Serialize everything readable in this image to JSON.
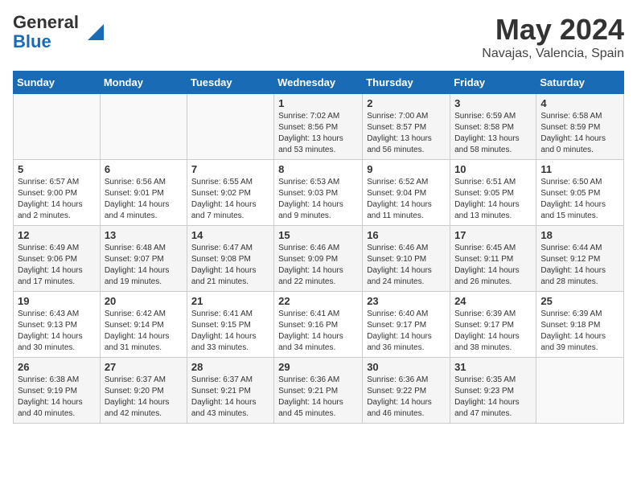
{
  "header": {
    "logo_general": "General",
    "logo_blue": "Blue",
    "month_year": "May 2024",
    "location": "Navajas, Valencia, Spain"
  },
  "weekdays": [
    "Sunday",
    "Monday",
    "Tuesday",
    "Wednesday",
    "Thursday",
    "Friday",
    "Saturday"
  ],
  "weeks": [
    [
      {
        "day": "",
        "info": ""
      },
      {
        "day": "",
        "info": ""
      },
      {
        "day": "",
        "info": ""
      },
      {
        "day": "1",
        "info": "Sunrise: 7:02 AM\nSunset: 8:56 PM\nDaylight: 13 hours\nand 53 minutes."
      },
      {
        "day": "2",
        "info": "Sunrise: 7:00 AM\nSunset: 8:57 PM\nDaylight: 13 hours\nand 56 minutes."
      },
      {
        "day": "3",
        "info": "Sunrise: 6:59 AM\nSunset: 8:58 PM\nDaylight: 13 hours\nand 58 minutes."
      },
      {
        "day": "4",
        "info": "Sunrise: 6:58 AM\nSunset: 8:59 PM\nDaylight: 14 hours\nand 0 minutes."
      }
    ],
    [
      {
        "day": "5",
        "info": "Sunrise: 6:57 AM\nSunset: 9:00 PM\nDaylight: 14 hours\nand 2 minutes."
      },
      {
        "day": "6",
        "info": "Sunrise: 6:56 AM\nSunset: 9:01 PM\nDaylight: 14 hours\nand 4 minutes."
      },
      {
        "day": "7",
        "info": "Sunrise: 6:55 AM\nSunset: 9:02 PM\nDaylight: 14 hours\nand 7 minutes."
      },
      {
        "day": "8",
        "info": "Sunrise: 6:53 AM\nSunset: 9:03 PM\nDaylight: 14 hours\nand 9 minutes."
      },
      {
        "day": "9",
        "info": "Sunrise: 6:52 AM\nSunset: 9:04 PM\nDaylight: 14 hours\nand 11 minutes."
      },
      {
        "day": "10",
        "info": "Sunrise: 6:51 AM\nSunset: 9:05 PM\nDaylight: 14 hours\nand 13 minutes."
      },
      {
        "day": "11",
        "info": "Sunrise: 6:50 AM\nSunset: 9:05 PM\nDaylight: 14 hours\nand 15 minutes."
      }
    ],
    [
      {
        "day": "12",
        "info": "Sunrise: 6:49 AM\nSunset: 9:06 PM\nDaylight: 14 hours\nand 17 minutes."
      },
      {
        "day": "13",
        "info": "Sunrise: 6:48 AM\nSunset: 9:07 PM\nDaylight: 14 hours\nand 19 minutes."
      },
      {
        "day": "14",
        "info": "Sunrise: 6:47 AM\nSunset: 9:08 PM\nDaylight: 14 hours\nand 21 minutes."
      },
      {
        "day": "15",
        "info": "Sunrise: 6:46 AM\nSunset: 9:09 PM\nDaylight: 14 hours\nand 22 minutes."
      },
      {
        "day": "16",
        "info": "Sunrise: 6:46 AM\nSunset: 9:10 PM\nDaylight: 14 hours\nand 24 minutes."
      },
      {
        "day": "17",
        "info": "Sunrise: 6:45 AM\nSunset: 9:11 PM\nDaylight: 14 hours\nand 26 minutes."
      },
      {
        "day": "18",
        "info": "Sunrise: 6:44 AM\nSunset: 9:12 PM\nDaylight: 14 hours\nand 28 minutes."
      }
    ],
    [
      {
        "day": "19",
        "info": "Sunrise: 6:43 AM\nSunset: 9:13 PM\nDaylight: 14 hours\nand 30 minutes."
      },
      {
        "day": "20",
        "info": "Sunrise: 6:42 AM\nSunset: 9:14 PM\nDaylight: 14 hours\nand 31 minutes."
      },
      {
        "day": "21",
        "info": "Sunrise: 6:41 AM\nSunset: 9:15 PM\nDaylight: 14 hours\nand 33 minutes."
      },
      {
        "day": "22",
        "info": "Sunrise: 6:41 AM\nSunset: 9:16 PM\nDaylight: 14 hours\nand 34 minutes."
      },
      {
        "day": "23",
        "info": "Sunrise: 6:40 AM\nSunset: 9:17 PM\nDaylight: 14 hours\nand 36 minutes."
      },
      {
        "day": "24",
        "info": "Sunrise: 6:39 AM\nSunset: 9:17 PM\nDaylight: 14 hours\nand 38 minutes."
      },
      {
        "day": "25",
        "info": "Sunrise: 6:39 AM\nSunset: 9:18 PM\nDaylight: 14 hours\nand 39 minutes."
      }
    ],
    [
      {
        "day": "26",
        "info": "Sunrise: 6:38 AM\nSunset: 9:19 PM\nDaylight: 14 hours\nand 40 minutes."
      },
      {
        "day": "27",
        "info": "Sunrise: 6:37 AM\nSunset: 9:20 PM\nDaylight: 14 hours\nand 42 minutes."
      },
      {
        "day": "28",
        "info": "Sunrise: 6:37 AM\nSunset: 9:21 PM\nDaylight: 14 hours\nand 43 minutes."
      },
      {
        "day": "29",
        "info": "Sunrise: 6:36 AM\nSunset: 9:21 PM\nDaylight: 14 hours\nand 45 minutes."
      },
      {
        "day": "30",
        "info": "Sunrise: 6:36 AM\nSunset: 9:22 PM\nDaylight: 14 hours\nand 46 minutes."
      },
      {
        "day": "31",
        "info": "Sunrise: 6:35 AM\nSunset: 9:23 PM\nDaylight: 14 hours\nand 47 minutes."
      },
      {
        "day": "",
        "info": ""
      }
    ]
  ]
}
